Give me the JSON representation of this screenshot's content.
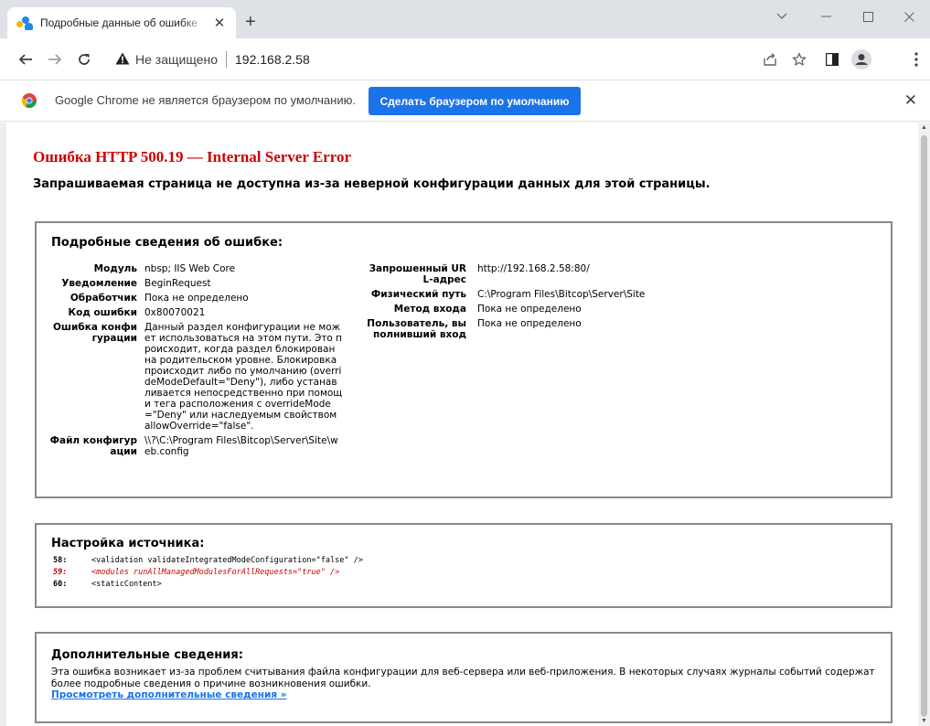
{
  "browser": {
    "tab_title": "Подробные данные об ошибке",
    "address_security": "Не защищено",
    "address_url": "192.168.2.58",
    "infobar_message": "Google Chrome не является браузером по умолчанию.",
    "infobar_button": "Сделать браузером по умолчанию"
  },
  "page": {
    "title": "Ошибка HTTP 500.19 — Internal Server Error",
    "subtitle": "Запрашиваемая страница не доступна из-за неверной конфигурации данных для этой страницы.",
    "details": {
      "heading": "Подробные сведения об ошибке:",
      "left": [
        {
          "key": "Модуль",
          "value": "nbsp; IIS Web Core"
        },
        {
          "key": "Уведомление",
          "value": "BeginRequest"
        },
        {
          "key": "Обработчик",
          "value": "Пока не определено"
        },
        {
          "key": "Код ошибки",
          "value": "0x80070021"
        },
        {
          "key": "Ошибка конфигурации",
          "value": "Данный раздел конфигурации не может использоваться на этом пути. Это происходит, когда раздел блокирован на родительском уровне. Блокировка происходит либо по умолчанию (overrideModeDefault=\"Deny\"), либо устанавливается непосредственно при помощи тега расположения с overrideMode=\"Deny\" или наследуемым свойством allowOverride=\"false\"."
        },
        {
          "key": "Файл конфигурации",
          "value": "\\\\?\\C:\\Program Files\\Bitcop\\Server\\Site\\web.config"
        }
      ],
      "right": [
        {
          "key": "Запрошенный URL-адрес",
          "value": "http://192.168.2.58:80/"
        },
        {
          "key": "Физический путь",
          "value": "C:\\Program Files\\Bitcop\\Server\\Site"
        },
        {
          "key": "Метод входа",
          "value": "Пока не определено"
        },
        {
          "key": "Пользователь, выполнивший вход",
          "value": "Пока не определено"
        }
      ]
    },
    "source": {
      "heading": "Настройка источника:",
      "lines": [
        {
          "num": "58:",
          "code": "<validation validateIntegratedModeConfiguration=\"false\" />"
        },
        {
          "num": "59:",
          "code": "<modules runAllManagedModulesForAllRequests=\"true\" />"
        },
        {
          "num": "60:",
          "code": "<staticContent>"
        }
      ]
    },
    "more": {
      "heading": "Дополнительные сведения:",
      "text": "Эта ошибка возникает из-за проблем считывания файла конфигурации для веб-сервера или веб-приложения. В некоторых случаях журналы событий содержат более подробные сведения о причине возникновения ошибки.",
      "link": "Просмотреть дополнительные сведения »"
    }
  }
}
